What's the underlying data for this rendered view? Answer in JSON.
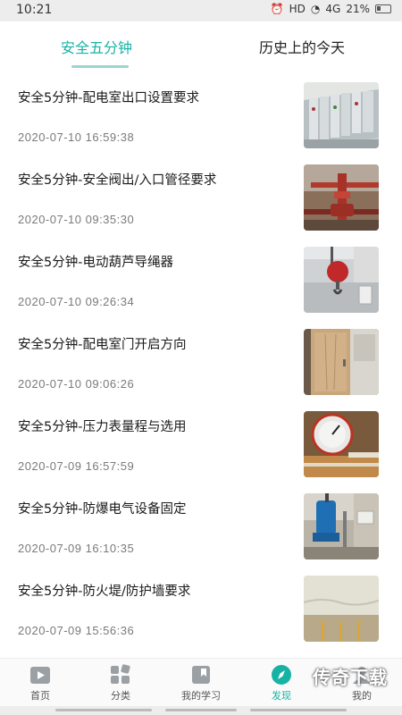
{
  "status_bar": {
    "time": "10:21",
    "network": "HD",
    "signal": "4G",
    "battery": "21%"
  },
  "tabs": [
    {
      "label": "安全五分钟",
      "active": true
    },
    {
      "label": "历史上的今天",
      "active": false
    }
  ],
  "colors": {
    "accent": "#16b3a5",
    "indicator": "#9ad5cf"
  },
  "articles": [
    {
      "title": "安全5分钟-配电室出口设置要求",
      "date": "2020-07-10 16:59:38",
      "image": "switchgear-room"
    },
    {
      "title": "安全5分钟-安全阀出/入口管径要求",
      "date": "2020-07-10 09:35:30",
      "image": "valve-pipes"
    },
    {
      "title": "安全5分钟-电动葫芦导绳器",
      "date": "2020-07-10 09:26:34",
      "image": "electric-hoist"
    },
    {
      "title": "  安全5分钟-配电室门开启方向",
      "date": "2020-07-10 09:06:26",
      "image": "wooden-door"
    },
    {
      "title": "安全5分钟-压力表量程与选用",
      "date": "2020-07-09 16:57:59",
      "image": "pressure-gauge"
    },
    {
      "title": "安全5分钟-防爆电气设备固定",
      "date": "2020-07-09 16:10:35",
      "image": "explosion-proof-motor"
    },
    {
      "title": "安全5分钟-防火堤/防护墙要求",
      "date": "2020-07-09 15:56:36",
      "image": "concrete-wall"
    }
  ],
  "bottom_nav": [
    {
      "label": "首页",
      "icon": "home-icon",
      "active": false
    },
    {
      "label": "分类",
      "icon": "category-icon",
      "active": false
    },
    {
      "label": "我的学习",
      "icon": "bookmark-icon",
      "active": false
    },
    {
      "label": "发现",
      "icon": "compass-icon",
      "active": true
    },
    {
      "label": "我的",
      "icon": "profile-icon",
      "active": false
    }
  ],
  "watermark": "传奇下载"
}
